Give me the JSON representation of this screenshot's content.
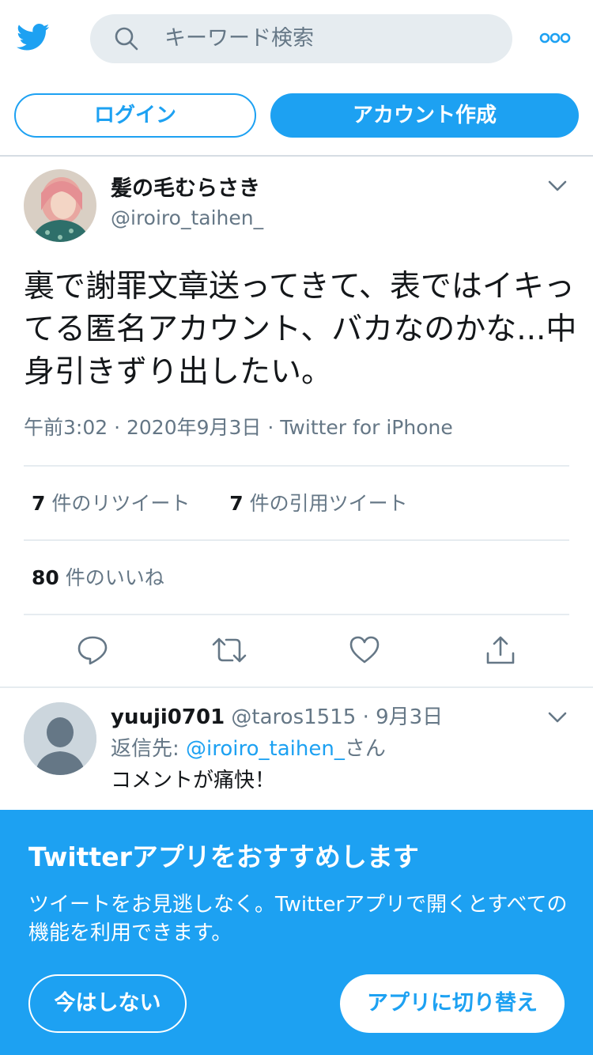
{
  "header": {
    "logo_icon": "twitter-bird-icon",
    "search_placeholder": "キーワード検索",
    "more_icon": "more-dots-icon"
  },
  "auth": {
    "login_label": "ログイン",
    "signup_label": "アカウント作成"
  },
  "tweet": {
    "display_name": "髪の毛むらさき",
    "handle": "@iroiro_taihen_",
    "text": "裏で謝罪文章送ってきて、表ではイキってる匿名アカウント、バカなのかな...中身引きずり出したい。",
    "time": "午前3:02",
    "date": "2020年9月3日",
    "source": "Twitter for iPhone",
    "retweets_count": "7",
    "retweets_label": "件のリツイート",
    "quotes_count": "7",
    "quotes_label": "件の引用ツイート",
    "likes_count": "80",
    "likes_label": "件のいいね",
    "actions": [
      "reply-icon",
      "retweet-icon",
      "like-icon",
      "share-icon"
    ]
  },
  "reply": {
    "display_name": "yuuji0701",
    "handle": "@taros1515",
    "date": "9月3日",
    "reply_to_prefix": "返信先: ",
    "reply_to_handle": "@iroiro_taihen_",
    "reply_to_suffix": "さん",
    "text": "コメントが痛快！"
  },
  "banner": {
    "title": "Twitterアプリをおすすめします",
    "body": "ツイートをお見逃しなく。Twitterアプリで開くとすべての機能を利用できます。",
    "not_now_label": "今はしない",
    "switch_label": "アプリに切り替え"
  },
  "colors": {
    "brand": "#1da1f2",
    "secondary_text": "#657786",
    "primary_text": "#14171a",
    "divider": "#e6ecf0"
  }
}
